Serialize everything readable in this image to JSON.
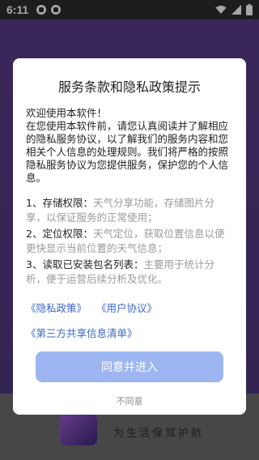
{
  "status_bar": {
    "time": "6:11"
  },
  "background": {
    "slogan": "为生活保驾护航"
  },
  "dialog": {
    "title": "服务条款和隐私政策提示",
    "intro": "欢迎使用本软件！\n在您使用本软件前，请您认真阅读并了解相应的隐私服务协议，以了解我们的服务内容和您相关个人信息的处理规则。我们将严格的按照隐私服务协议为您提供服务，保护您的个人信息。",
    "permissions": [
      {
        "label": "1、存储权限：",
        "desc": "天气分享功能，存储图片分享，以保证服务的正常使用；"
      },
      {
        "label": "2、定位权限：",
        "desc": "天气定位，获取位置信息以便更快显示当前位置的天气信息；"
      },
      {
        "label": "3、读取已安装包名列表：",
        "desc": "主要用于统计分析，便于运营后续分析及优化。"
      }
    ],
    "links": {
      "privacy_policy": "《隐私政策》",
      "user_agreement": "《用户协议》",
      "third_party_list": "《第三方共享信息清单》"
    },
    "agree_label": "同意并进入",
    "disagree_label": "不同意"
  }
}
